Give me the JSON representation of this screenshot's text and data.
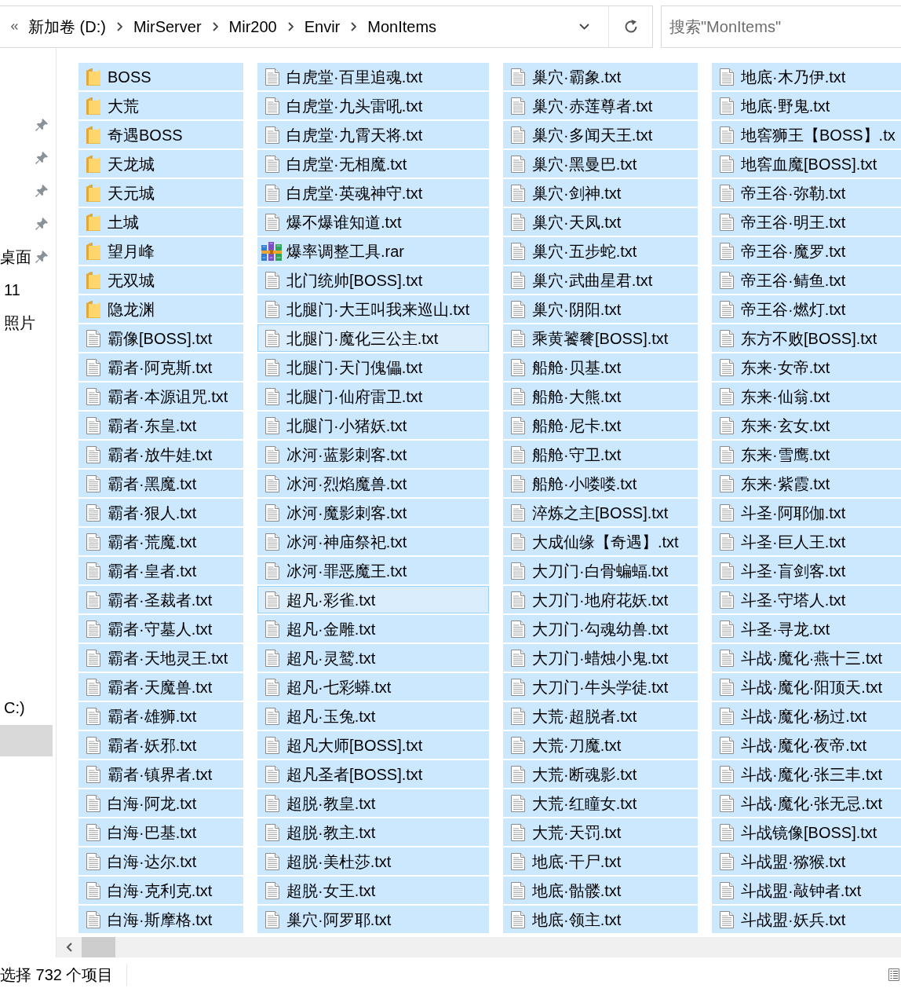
{
  "address_bar": {
    "breadcrumbs": [
      "新加卷 (D:)",
      "MirServer",
      "Mir200",
      "Envir",
      "MonItems"
    ]
  },
  "search": {
    "placeholder": "搜索\"MonItems\""
  },
  "nav_pane": {
    "items": [
      {
        "pinned": true,
        "selected": false
      },
      {
        "pinned": true,
        "selected": false
      },
      {
        "pinned": true,
        "selected": false
      },
      {
        "pinned": true,
        "selected": false
      },
      {
        "label": "桌面",
        "pinned": true,
        "selected": false
      },
      {
        "label": "11",
        "pinned": false,
        "selected": false
      },
      {
        "label": "照片",
        "pinned": false,
        "selected": false
      }
    ],
    "lower_items": [
      {
        "label": "C:)",
        "pinned": false,
        "selected": false
      },
      {
        "pinned": false,
        "selected": true
      }
    ]
  },
  "items": [
    {
      "name": "BOSS",
      "kind": "folder",
      "selected": true,
      "highlighted": false
    },
    {
      "name": "大荒",
      "kind": "folder",
      "selected": true,
      "highlighted": false
    },
    {
      "name": "奇遇BOSS",
      "kind": "folder",
      "selected": true,
      "highlighted": false
    },
    {
      "name": "天龙城",
      "kind": "folder",
      "selected": true,
      "highlighted": false
    },
    {
      "name": "天元城",
      "kind": "folder",
      "selected": true,
      "highlighted": false
    },
    {
      "name": "土城",
      "kind": "folder",
      "selected": true,
      "highlighted": false
    },
    {
      "name": "望月峰",
      "kind": "folder",
      "selected": true,
      "highlighted": false
    },
    {
      "name": "无双城",
      "kind": "folder",
      "selected": true,
      "highlighted": false
    },
    {
      "name": "隐龙渊",
      "kind": "folder",
      "selected": true,
      "highlighted": false
    },
    {
      "name": "霸像[BOSS].txt",
      "kind": "text",
      "selected": true,
      "highlighted": false
    },
    {
      "name": "霸者·阿克斯.txt",
      "kind": "text",
      "selected": true,
      "highlighted": false
    },
    {
      "name": "霸者·本源诅咒.txt",
      "kind": "text",
      "selected": true,
      "highlighted": false
    },
    {
      "name": "霸者·东皇.txt",
      "kind": "text",
      "selected": true,
      "highlighted": false
    },
    {
      "name": "霸者·放牛娃.txt",
      "kind": "text",
      "selected": true,
      "highlighted": false
    },
    {
      "name": "霸者·黑魔.txt",
      "kind": "text",
      "selected": true,
      "highlighted": false
    },
    {
      "name": "霸者·狠人.txt",
      "kind": "text",
      "selected": true,
      "highlighted": false
    },
    {
      "name": "霸者·荒魔.txt",
      "kind": "text",
      "selected": true,
      "highlighted": false
    },
    {
      "name": "霸者·皇者.txt",
      "kind": "text",
      "selected": true,
      "highlighted": false
    },
    {
      "name": "霸者·圣裁者.txt",
      "kind": "text",
      "selected": true,
      "highlighted": false
    },
    {
      "name": "霸者·守墓人.txt",
      "kind": "text",
      "selected": true,
      "highlighted": false
    },
    {
      "name": "霸者·天地灵王.txt",
      "kind": "text",
      "selected": true,
      "highlighted": false
    },
    {
      "name": "霸者·天魔兽.txt",
      "kind": "text",
      "selected": true,
      "highlighted": false
    },
    {
      "name": "霸者·雄狮.txt",
      "kind": "text",
      "selected": true,
      "highlighted": false
    },
    {
      "name": "霸者·妖邪.txt",
      "kind": "text",
      "selected": true,
      "highlighted": false
    },
    {
      "name": "霸者·镇界者.txt",
      "kind": "text",
      "selected": true,
      "highlighted": false
    },
    {
      "name": "白海·阿龙.txt",
      "kind": "text",
      "selected": true,
      "highlighted": false
    },
    {
      "name": "白海·巴基.txt",
      "kind": "text",
      "selected": true,
      "highlighted": false
    },
    {
      "name": "白海·达尔.txt",
      "kind": "text",
      "selected": true,
      "highlighted": false
    },
    {
      "name": "白海·克利克.txt",
      "kind": "text",
      "selected": true,
      "highlighted": false
    },
    {
      "name": "白海·斯摩格.txt",
      "kind": "text",
      "selected": true,
      "highlighted": false
    },
    {
      "name": "白虎堂·百里追魂.txt",
      "kind": "text",
      "selected": true,
      "highlighted": false
    },
    {
      "name": "白虎堂·九头雷吼.txt",
      "kind": "text",
      "selected": true,
      "highlighted": false
    },
    {
      "name": "白虎堂·九霄天将.txt",
      "kind": "text",
      "selected": true,
      "highlighted": false
    },
    {
      "name": "白虎堂·无相魔.txt",
      "kind": "text",
      "selected": true,
      "highlighted": false
    },
    {
      "name": "白虎堂·英魂神守.txt",
      "kind": "text",
      "selected": true,
      "highlighted": false
    },
    {
      "name": "爆不爆谁知道.txt",
      "kind": "text",
      "selected": true,
      "highlighted": false
    },
    {
      "name": "爆率调整工具.rar",
      "kind": "archive",
      "selected": true,
      "highlighted": false
    },
    {
      "name": "北门统帅[BOSS].txt",
      "kind": "text",
      "selected": true,
      "highlighted": false
    },
    {
      "name": "北腿门·大王叫我来巡山.txt",
      "kind": "text",
      "selected": true,
      "highlighted": false
    },
    {
      "name": "北腿门·魔化三公主.txt",
      "kind": "text",
      "selected": true,
      "highlighted": true
    },
    {
      "name": "北腿门·天门傀儡.txt",
      "kind": "text",
      "selected": true,
      "highlighted": false
    },
    {
      "name": "北腿门·仙府雷卫.txt",
      "kind": "text",
      "selected": true,
      "highlighted": false
    },
    {
      "name": "北腿门·小猪妖.txt",
      "kind": "text",
      "selected": true,
      "highlighted": false
    },
    {
      "name": "冰河·蓝影刺客.txt",
      "kind": "text",
      "selected": true,
      "highlighted": false
    },
    {
      "name": "冰河·烈焰魔兽.txt",
      "kind": "text",
      "selected": true,
      "highlighted": false
    },
    {
      "name": "冰河·魔影刺客.txt",
      "kind": "text",
      "selected": true,
      "highlighted": false
    },
    {
      "name": "冰河·神庙祭祀.txt",
      "kind": "text",
      "selected": true,
      "highlighted": false
    },
    {
      "name": "冰河·罪恶魔王.txt",
      "kind": "text",
      "selected": true,
      "highlighted": false
    },
    {
      "name": "超凡·彩雀.txt",
      "kind": "text",
      "selected": true,
      "highlighted": true
    },
    {
      "name": "超凡·金雕.txt",
      "kind": "text",
      "selected": true,
      "highlighted": false
    },
    {
      "name": "超凡·灵鹫.txt",
      "kind": "text",
      "selected": true,
      "highlighted": false
    },
    {
      "name": "超凡·七彩蟒.txt",
      "kind": "text",
      "selected": true,
      "highlighted": false
    },
    {
      "name": "超凡·玉兔.txt",
      "kind": "text",
      "selected": true,
      "highlighted": false
    },
    {
      "name": "超凡大师[BOSS].txt",
      "kind": "text",
      "selected": true,
      "highlighted": false
    },
    {
      "name": "超凡圣者[BOSS].txt",
      "kind": "text",
      "selected": true,
      "highlighted": false
    },
    {
      "name": "超脱·教皇.txt",
      "kind": "text",
      "selected": true,
      "highlighted": false
    },
    {
      "name": "超脱·教主.txt",
      "kind": "text",
      "selected": true,
      "highlighted": false
    },
    {
      "name": "超脱·美杜莎.txt",
      "kind": "text",
      "selected": true,
      "highlighted": false
    },
    {
      "name": "超脱·女王.txt",
      "kind": "text",
      "selected": true,
      "highlighted": false
    },
    {
      "name": "巢穴·阿罗耶.txt",
      "kind": "text",
      "selected": true,
      "highlighted": false
    },
    {
      "name": "巢穴·霸象.txt",
      "kind": "text",
      "selected": true,
      "highlighted": false
    },
    {
      "name": "巢穴·赤莲尊者.txt",
      "kind": "text",
      "selected": true,
      "highlighted": false
    },
    {
      "name": "巢穴·多闻天王.txt",
      "kind": "text",
      "selected": true,
      "highlighted": false
    },
    {
      "name": "巢穴·黑曼巴.txt",
      "kind": "text",
      "selected": true,
      "highlighted": false
    },
    {
      "name": "巢穴·剑神.txt",
      "kind": "text",
      "selected": true,
      "highlighted": false
    },
    {
      "name": "巢穴·天凤.txt",
      "kind": "text",
      "selected": true,
      "highlighted": false
    },
    {
      "name": "巢穴·五步蛇.txt",
      "kind": "text",
      "selected": true,
      "highlighted": false
    },
    {
      "name": "巢穴·武曲星君.txt",
      "kind": "text",
      "selected": true,
      "highlighted": false
    },
    {
      "name": "巢穴·阴阳.txt",
      "kind": "text",
      "selected": true,
      "highlighted": false
    },
    {
      "name": "乘黄饕餮[BOSS].txt",
      "kind": "text",
      "selected": true,
      "highlighted": false
    },
    {
      "name": "船舱·贝基.txt",
      "kind": "text",
      "selected": true,
      "highlighted": false
    },
    {
      "name": "船舱·大熊.txt",
      "kind": "text",
      "selected": true,
      "highlighted": false
    },
    {
      "name": "船舱·尼卡.txt",
      "kind": "text",
      "selected": true,
      "highlighted": false
    },
    {
      "name": "船舱·守卫.txt",
      "kind": "text",
      "selected": true,
      "highlighted": false
    },
    {
      "name": "船舱·小喽喽.txt",
      "kind": "text",
      "selected": true,
      "highlighted": false
    },
    {
      "name": "淬炼之主[BOSS].txt",
      "kind": "text",
      "selected": true,
      "highlighted": false
    },
    {
      "name": "大成仙缘【奇遇】.txt",
      "kind": "text",
      "selected": true,
      "highlighted": false
    },
    {
      "name": "大刀门·白骨蝙蝠.txt",
      "kind": "text",
      "selected": true,
      "highlighted": false
    },
    {
      "name": "大刀门·地府花妖.txt",
      "kind": "text",
      "selected": true,
      "highlighted": false
    },
    {
      "name": "大刀门·勾魂幼兽.txt",
      "kind": "text",
      "selected": true,
      "highlighted": false
    },
    {
      "name": "大刀门·蜡烛小鬼.txt",
      "kind": "text",
      "selected": true,
      "highlighted": false
    },
    {
      "name": "大刀门·牛头学徒.txt",
      "kind": "text",
      "selected": true,
      "highlighted": false
    },
    {
      "name": "大荒·超脱者.txt",
      "kind": "text",
      "selected": true,
      "highlighted": false
    },
    {
      "name": "大荒·刀魔.txt",
      "kind": "text",
      "selected": true,
      "highlighted": false
    },
    {
      "name": "大荒·断魂影.txt",
      "kind": "text",
      "selected": true,
      "highlighted": false
    },
    {
      "name": "大荒·红瞳女.txt",
      "kind": "text",
      "selected": true,
      "highlighted": false
    },
    {
      "name": "大荒·天罚.txt",
      "kind": "text",
      "selected": true,
      "highlighted": false
    },
    {
      "name": "地底·干尸.txt",
      "kind": "text",
      "selected": true,
      "highlighted": false
    },
    {
      "name": "地底·骷髅.txt",
      "kind": "text",
      "selected": true,
      "highlighted": false
    },
    {
      "name": "地底·领主.txt",
      "kind": "text",
      "selected": true,
      "highlighted": false
    },
    {
      "name": "地底·木乃伊.txt",
      "kind": "text",
      "selected": true,
      "highlighted": false
    },
    {
      "name": "地底·野鬼.txt",
      "kind": "text",
      "selected": true,
      "highlighted": false
    },
    {
      "name": "地窖狮王【BOSS】.tx",
      "kind": "text",
      "selected": true,
      "highlighted": false
    },
    {
      "name": "地窖血魔[BOSS].txt",
      "kind": "text",
      "selected": true,
      "highlighted": false
    },
    {
      "name": "帝王谷·弥勒.txt",
      "kind": "text",
      "selected": true,
      "highlighted": false
    },
    {
      "name": "帝王谷·明王.txt",
      "kind": "text",
      "selected": true,
      "highlighted": false
    },
    {
      "name": "帝王谷·魔罗.txt",
      "kind": "text",
      "selected": true,
      "highlighted": false
    },
    {
      "name": "帝王谷·鲭鱼.txt",
      "kind": "text",
      "selected": true,
      "highlighted": false
    },
    {
      "name": "帝王谷·燃灯.txt",
      "kind": "text",
      "selected": true,
      "highlighted": false
    },
    {
      "name": "东方不败[BOSS].txt",
      "kind": "text",
      "selected": true,
      "highlighted": false
    },
    {
      "name": "东来·女帝.txt",
      "kind": "text",
      "selected": true,
      "highlighted": false
    },
    {
      "name": "东来·仙翁.txt",
      "kind": "text",
      "selected": true,
      "highlighted": false
    },
    {
      "name": "东来·玄女.txt",
      "kind": "text",
      "selected": true,
      "highlighted": false
    },
    {
      "name": "东来·雪鹰.txt",
      "kind": "text",
      "selected": true,
      "highlighted": false
    },
    {
      "name": "东来·紫霞.txt",
      "kind": "text",
      "selected": true,
      "highlighted": false
    },
    {
      "name": "斗圣·阿耶伽.txt",
      "kind": "text",
      "selected": true,
      "highlighted": false
    },
    {
      "name": "斗圣·巨人王.txt",
      "kind": "text",
      "selected": true,
      "highlighted": false
    },
    {
      "name": "斗圣·盲剑客.txt",
      "kind": "text",
      "selected": true,
      "highlighted": false
    },
    {
      "name": "斗圣·守塔人.txt",
      "kind": "text",
      "selected": true,
      "highlighted": false
    },
    {
      "name": "斗圣·寻龙.txt",
      "kind": "text",
      "selected": true,
      "highlighted": false
    },
    {
      "name": "斗战·魔化·燕十三.txt",
      "kind": "text",
      "selected": true,
      "highlighted": false
    },
    {
      "name": "斗战·魔化·阳顶天.txt",
      "kind": "text",
      "selected": true,
      "highlighted": false
    },
    {
      "name": "斗战·魔化·杨过.txt",
      "kind": "text",
      "selected": true,
      "highlighted": false
    },
    {
      "name": "斗战·魔化·夜帝.txt",
      "kind": "text",
      "selected": true,
      "highlighted": false
    },
    {
      "name": "斗战·魔化·张三丰.txt",
      "kind": "text",
      "selected": true,
      "highlighted": false
    },
    {
      "name": "斗战·魔化·张无忌.txt",
      "kind": "text",
      "selected": true,
      "highlighted": false
    },
    {
      "name": "斗战镜像[BOSS].txt",
      "kind": "text",
      "selected": true,
      "highlighted": false
    },
    {
      "name": "斗战盟·猕猴.txt",
      "kind": "text",
      "selected": true,
      "highlighted": false
    },
    {
      "name": "斗战盟·敲钟者.txt",
      "kind": "text",
      "selected": true,
      "highlighted": false
    },
    {
      "name": "斗战盟·妖兵.txt",
      "kind": "text",
      "selected": true,
      "highlighted": false
    }
  ],
  "status_bar": {
    "text": "选择 732 个项目"
  }
}
